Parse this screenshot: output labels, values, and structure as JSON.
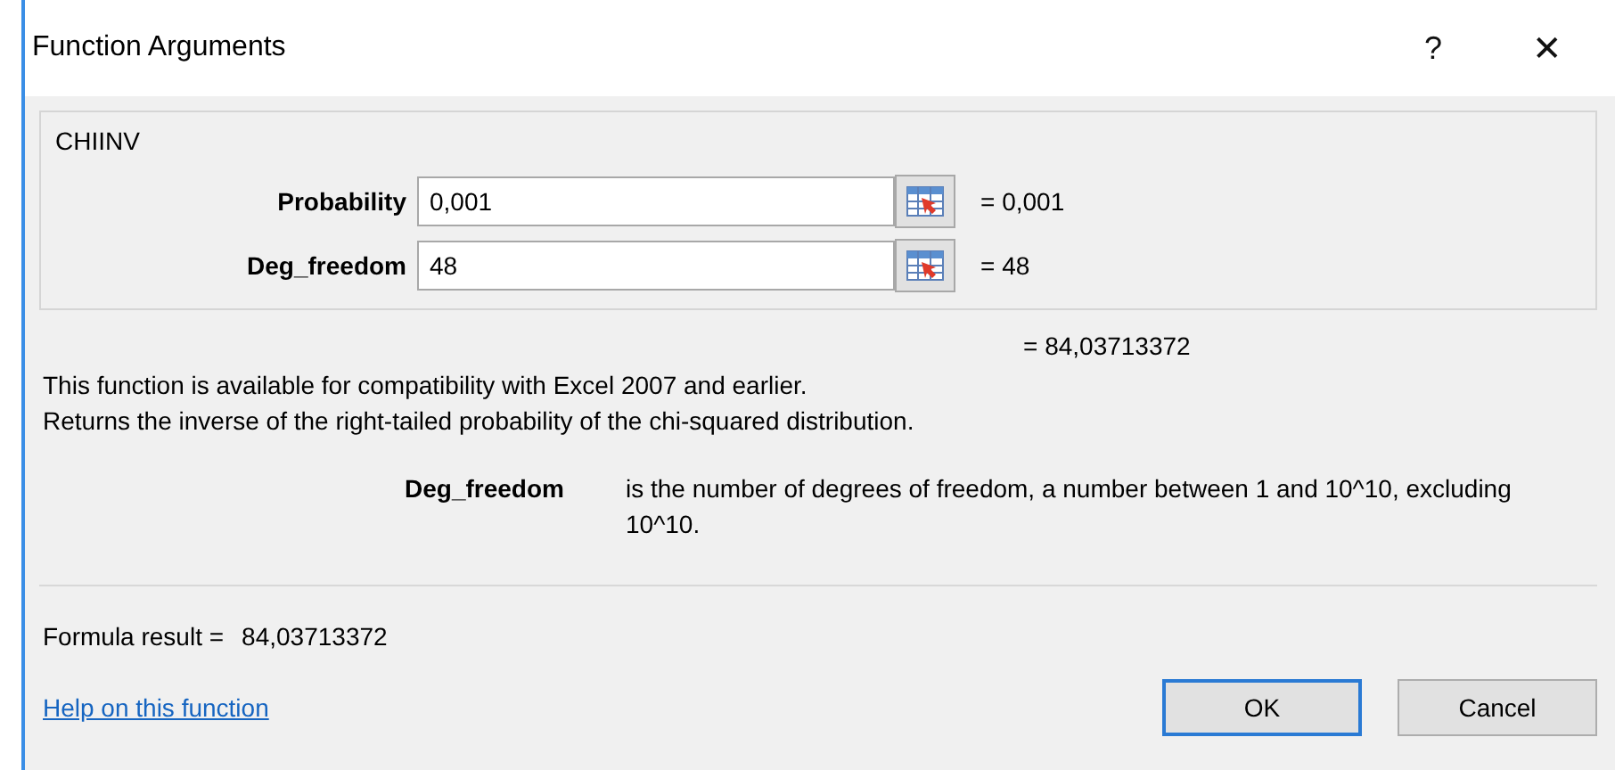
{
  "window": {
    "title": "Function Arguments",
    "help": "?",
    "close": "✕"
  },
  "function_name": "CHIINV",
  "arguments": [
    {
      "label": "Probability",
      "value": "0,001",
      "result": "= 0,001"
    },
    {
      "label": "Deg_freedom",
      "value": "48",
      "result": "= 48"
    }
  ],
  "result": "= 84,03713372",
  "description": [
    "This function is available for compatibility with Excel 2007 and earlier.",
    "Returns the inverse of the right-tailed probability of the chi-squared distribution."
  ],
  "argument_help": {
    "name": "Deg_freedom",
    "text": "is the number of degrees of freedom, a number between 1 and 10^10, excluding 10^10."
  },
  "formula_result": {
    "label": "Formula result =",
    "value": "84,03713372"
  },
  "help_link": "Help on this function",
  "buttons": [
    {
      "label": "OK",
      "default": true
    },
    {
      "label": "Cancel",
      "default": false
    }
  ]
}
